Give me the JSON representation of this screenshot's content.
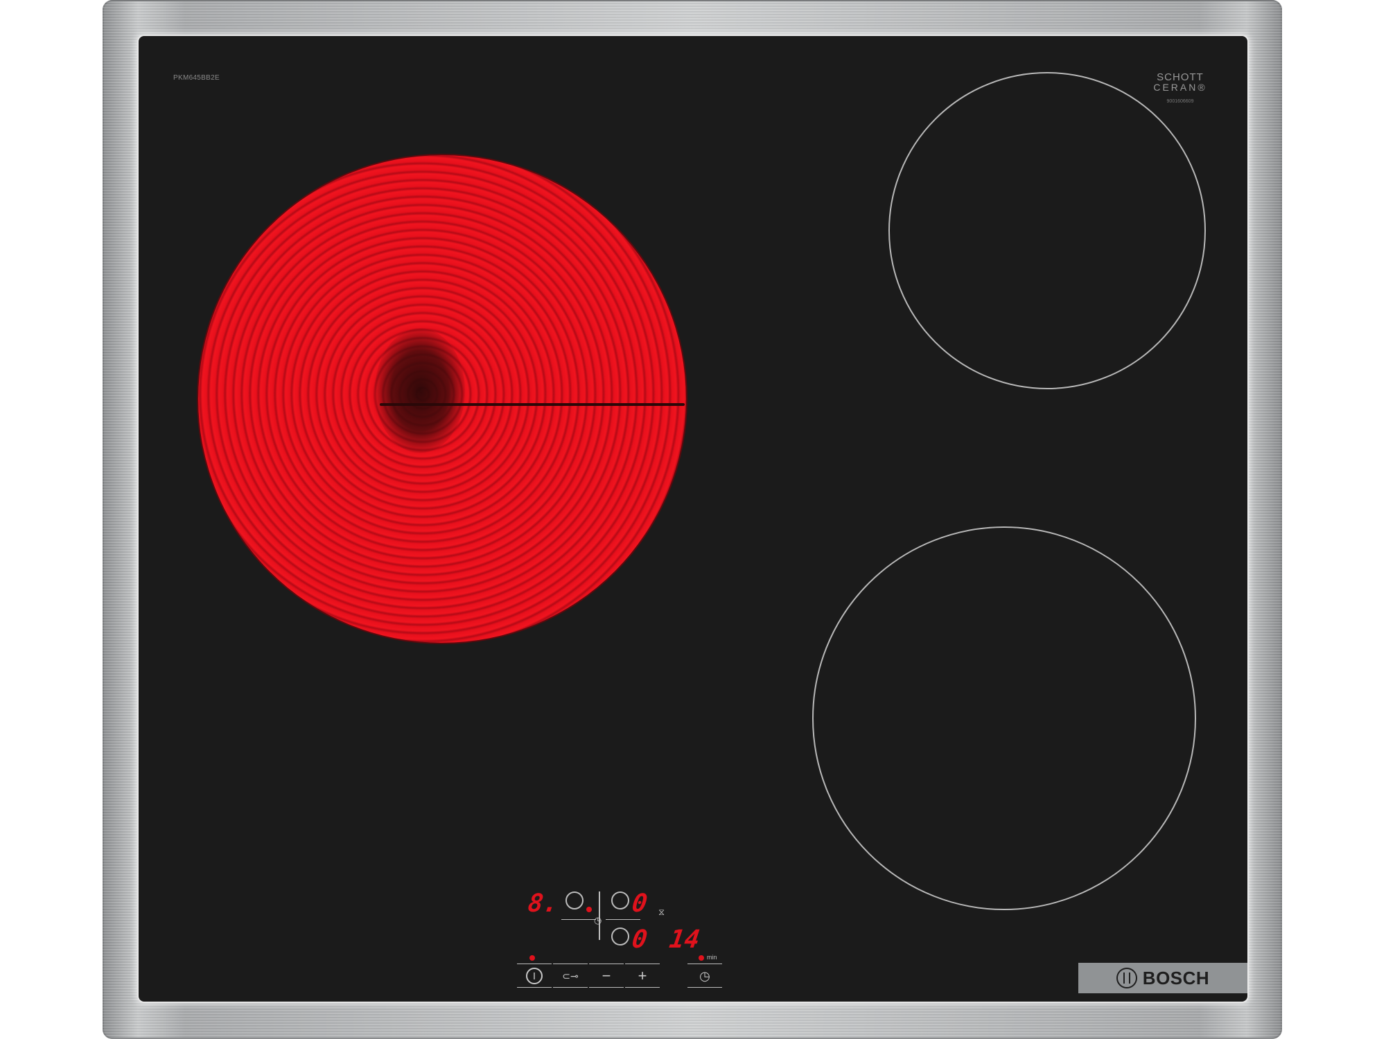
{
  "cooktop": {
    "model_label": "PKM645BB2E",
    "glass_brand_line1": "SCHOTT",
    "glass_brand_line2": "CERAN®",
    "glass_serial": "9001606609",
    "brand": "BOSCH"
  },
  "display": {
    "zone_power_level": "8.",
    "zone_level_2": "0",
    "zone_level_3": "0",
    "timer_minutes": "14",
    "timer_unit": "min"
  },
  "controls": {
    "power_symbol": "Ⅰ",
    "childlock_symbol": "⊂⊸",
    "minus_symbol": "−",
    "plus_symbol": "+",
    "timer_symbol": "◷",
    "hourglass_symbol": "⧖"
  },
  "colors": {
    "glass": "#1b1b1b",
    "hot_zone": "#e8101c",
    "display_red": "#e0121c",
    "frame_steel": "#c9cbcc"
  }
}
